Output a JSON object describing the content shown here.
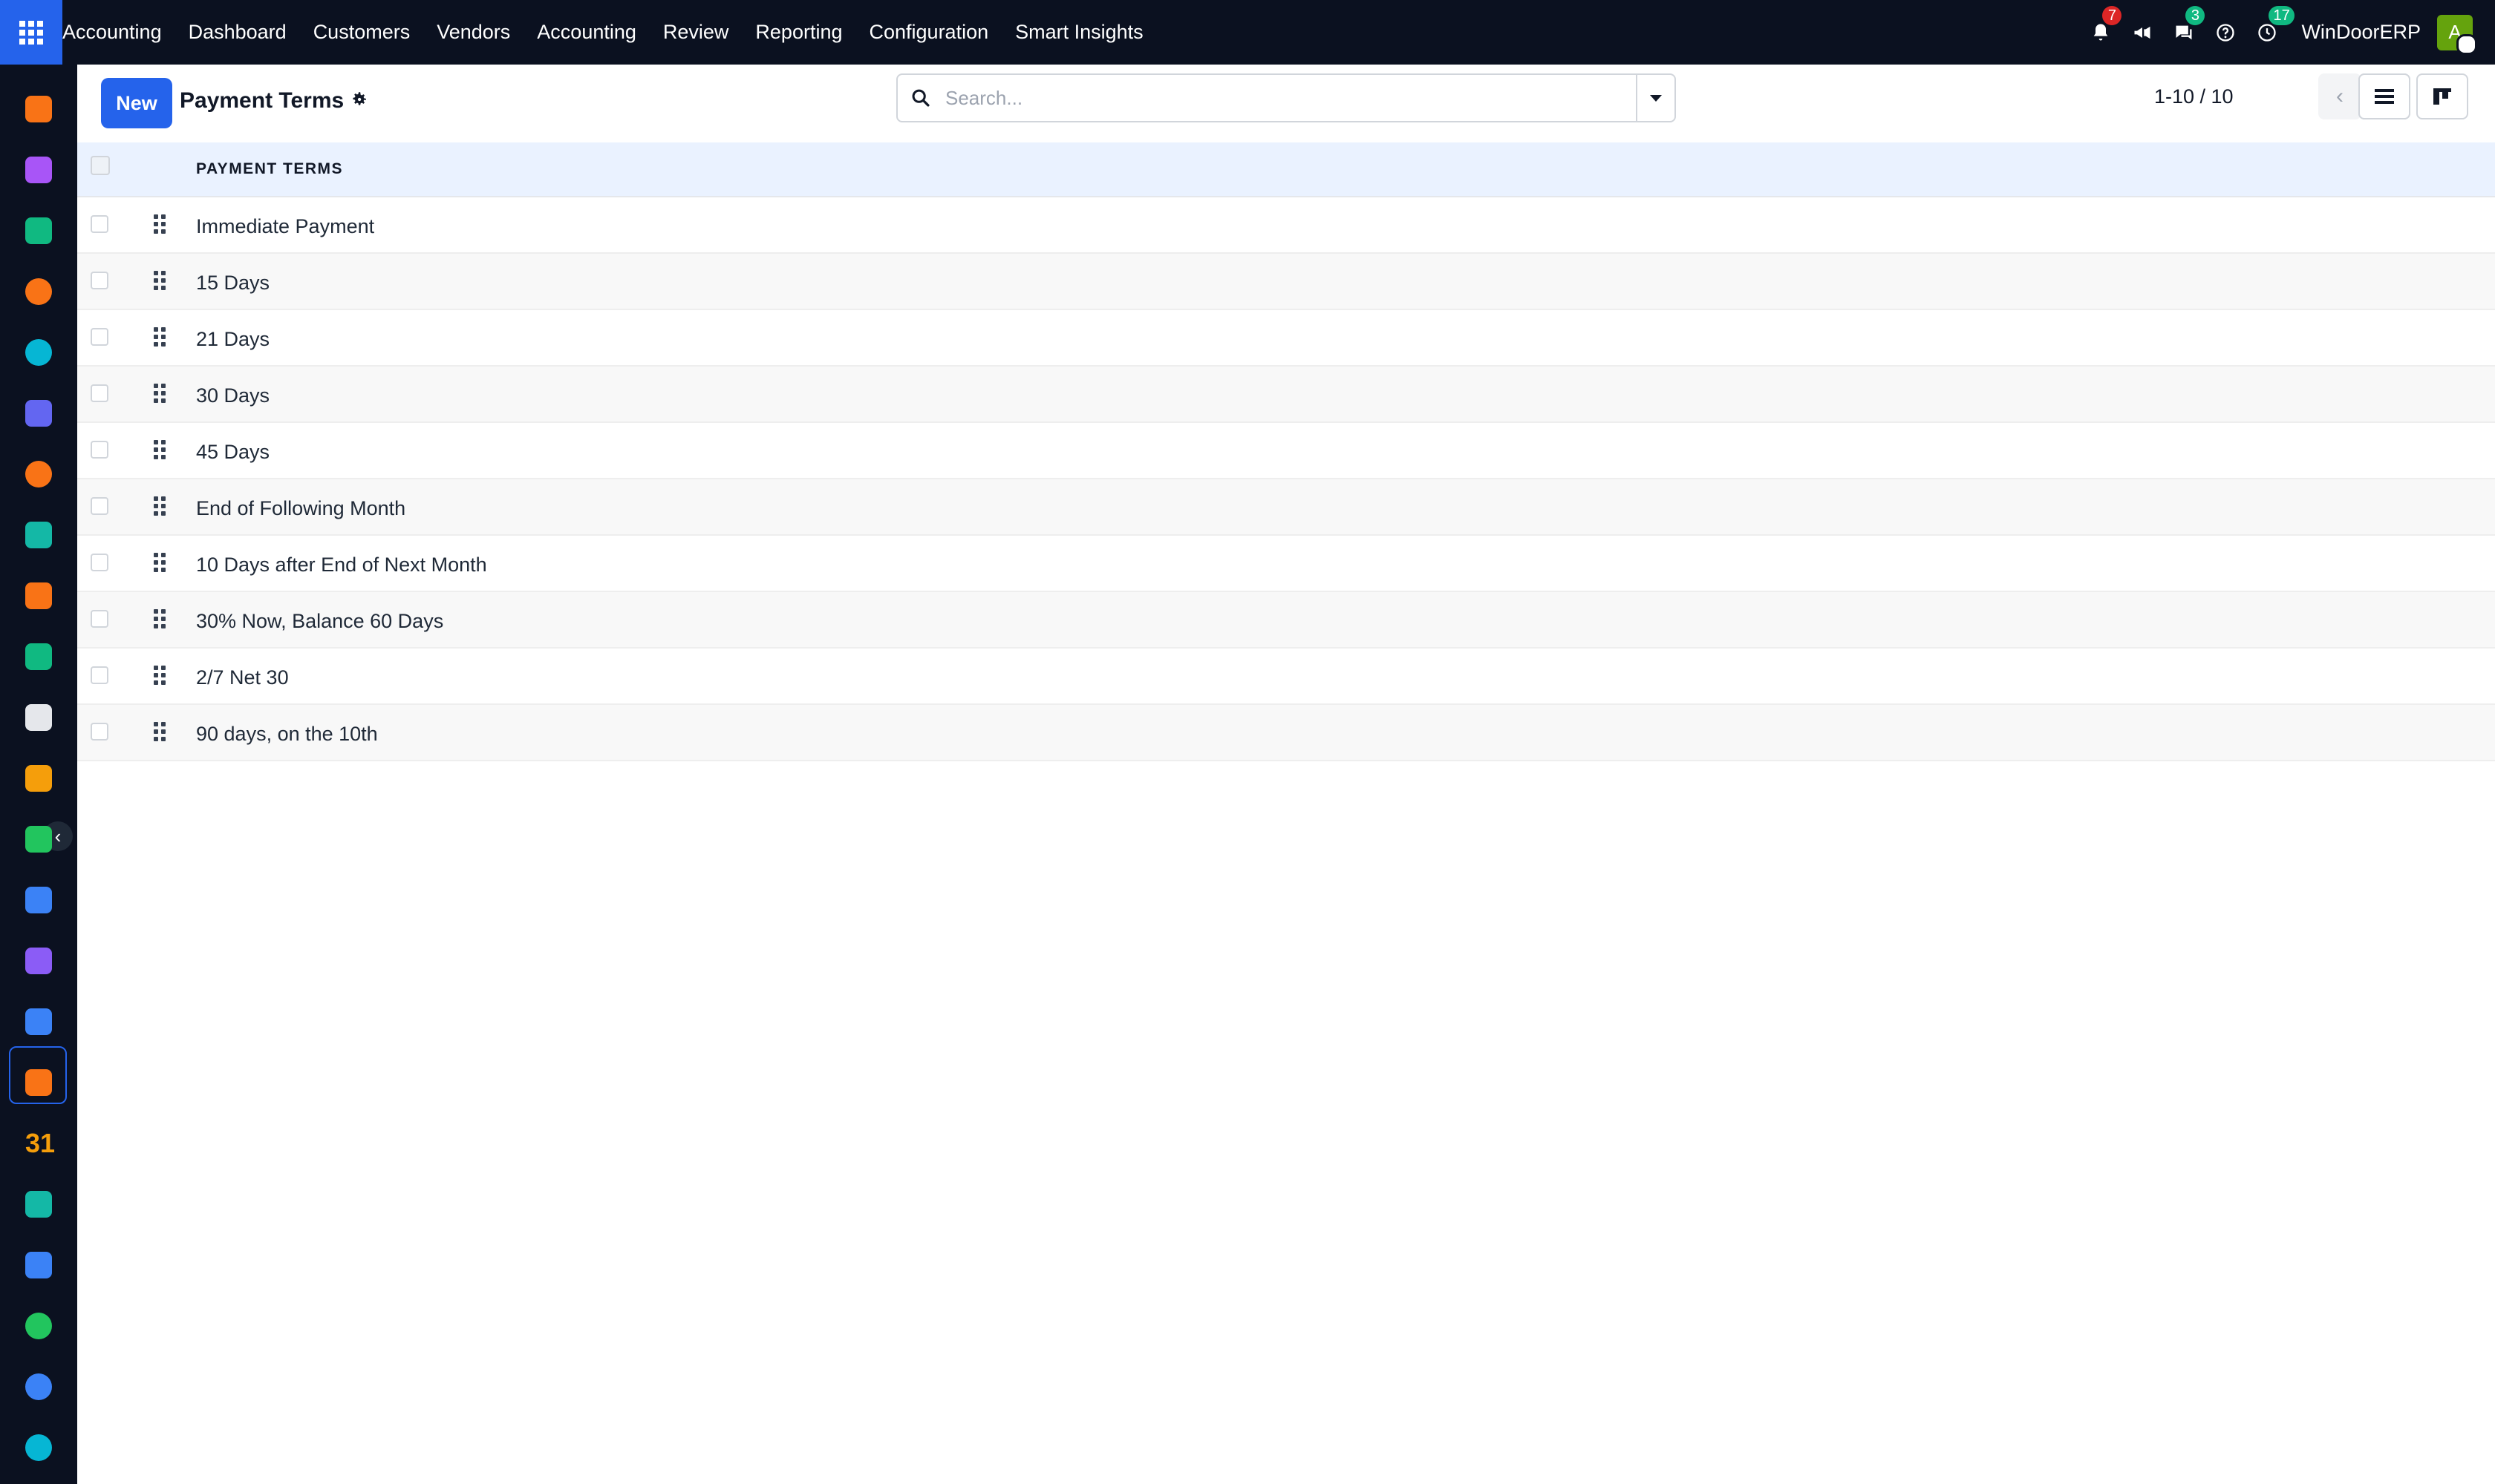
{
  "topbar": {
    "menu": [
      "Accounting",
      "Dashboard",
      "Customers",
      "Vendors",
      "Accounting",
      "Review",
      "Reporting",
      "Configuration",
      "Smart Insights"
    ],
    "notifications_count": "7",
    "messages_count": "3",
    "activities_count": "17",
    "company": "WinDoorERP",
    "avatar_letter": "A"
  },
  "control": {
    "new_label": "New",
    "title": "Payment Terms",
    "search_placeholder": "Search...",
    "pager": "1-10 / 10"
  },
  "table": {
    "header": "PAYMENT TERMS",
    "rows": [
      "Immediate Payment",
      "15 Days",
      "21 Days",
      "30 Days",
      "45 Days",
      "End of Following Month",
      "10 Days after End of Next Month",
      "30% Now, Balance 60 Days",
      "2/7 Net 30",
      "90 days, on the 10th"
    ]
  },
  "rail": {
    "apps": [
      {
        "name": "bar-chart-app-icon",
        "color": "#f97316"
      },
      {
        "name": "paint-app-icon",
        "color": "#a855f7"
      },
      {
        "name": "contacts-app-icon",
        "color": "#10b981"
      },
      {
        "name": "chat-app-icon",
        "color": "#f97316"
      },
      {
        "name": "wave-app-icon",
        "color": "#06b6d4"
      },
      {
        "name": "mail-app-icon",
        "color": "#6366f1"
      },
      {
        "name": "discuss-app-icon",
        "color": "#f97316"
      },
      {
        "name": "stock-app-icon",
        "color": "#14b8a6"
      },
      {
        "name": "reports-app-icon",
        "color": "#f97316"
      },
      {
        "name": "employees-app-icon",
        "color": "#10b981"
      },
      {
        "name": "package-app-icon",
        "color": "#e5e7eb"
      },
      {
        "name": "studio-app-icon",
        "color": "#f59e0b"
      },
      {
        "name": "tasks-app-icon",
        "color": "#22c55e"
      },
      {
        "name": "knowledge-app-icon",
        "color": "#3b82f6"
      },
      {
        "name": "inventory-app-icon",
        "color": "#8b5cf6"
      },
      {
        "name": "invoicing-app-icon",
        "color": "#3b82f6"
      },
      {
        "name": "team-app-icon",
        "color": "#f97316"
      },
      {
        "name": "calendar-app-icon",
        "color": "#f59e0b"
      },
      {
        "name": "sign-app-icon",
        "color": "#14b8a6"
      },
      {
        "name": "dashboard-app-icon",
        "color": "#3b82f6"
      },
      {
        "name": "whatsapp-app-icon",
        "color": "#22c55e"
      },
      {
        "name": "clock-app-icon",
        "color": "#3b82f6"
      },
      {
        "name": "wave2-app-icon",
        "color": "#06b6d4"
      }
    ],
    "calendar_text": "31"
  }
}
